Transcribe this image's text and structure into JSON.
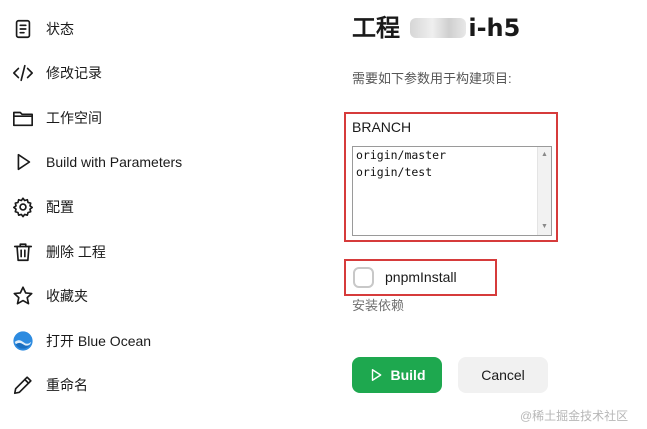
{
  "sidebar": {
    "items": [
      {
        "label": "状态",
        "icon": "document-icon"
      },
      {
        "label": "修改记录",
        "icon": "code-icon"
      },
      {
        "label": "工作空间",
        "icon": "folder-icon"
      },
      {
        "label": "Build with Parameters",
        "icon": "play-icon"
      },
      {
        "label": "配置",
        "icon": "gear-icon"
      },
      {
        "label": "删除 工程",
        "icon": "trash-icon"
      },
      {
        "label": "收藏夹",
        "icon": "star-icon"
      },
      {
        "label": "打开 Blue Ocean",
        "icon": "blue-ocean-icon"
      },
      {
        "label": "重命名",
        "icon": "pencil-icon"
      }
    ]
  },
  "header": {
    "title_prefix": "工程",
    "title_suffix": "i-h5",
    "subtitle": "需要如下参数用于构建项目:"
  },
  "params": {
    "branch": {
      "label": "BRANCH",
      "options": [
        "origin/master",
        "origin/test"
      ]
    },
    "pnpm": {
      "label": "pnpmInstall",
      "description": "安装依赖",
      "checked": false
    }
  },
  "actions": {
    "build_label": "Build",
    "cancel_label": "Cancel"
  },
  "watermark": "@稀土掘金技术社区",
  "colors": {
    "build_green": "#1ea84f",
    "highlight_red": "#d63b3b",
    "blue_ocean": "#2d8be0"
  }
}
